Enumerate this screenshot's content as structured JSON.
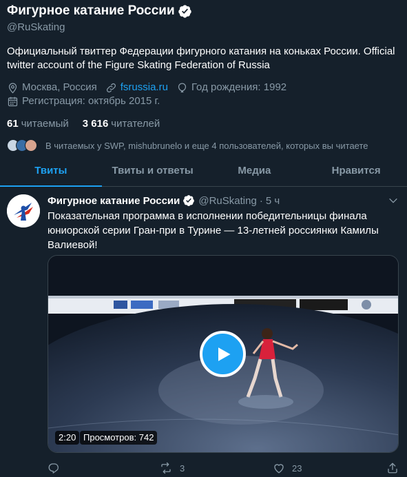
{
  "profile": {
    "display_name": "Фигурное катание России",
    "handle": "@RuSkating",
    "bio": "Официальный твиттер Федерации фигурного катания на коньках России. Official twitter account of the Figure Skating Federation of Russia",
    "location": "Москва, Россия",
    "website": "fsrussia.ru",
    "birth": "Год рождения: 1992",
    "joined": "Регистрация: октябрь 2015 г.",
    "following_count": "61",
    "following_label": "читаемый",
    "followers_count": "3 616",
    "followers_label": "читателей",
    "followed_by": "В читаемых у SWP, mishubrunelo и еще 4 пользователей, которых вы читаете"
  },
  "tabs": [
    {
      "label": "Твиты"
    },
    {
      "label": "Твиты и ответы"
    },
    {
      "label": "Медиа"
    },
    {
      "label": "Нравится"
    }
  ],
  "tweet": {
    "name": "Фигурное катание России",
    "handle": "@RuSkating",
    "dot": "·",
    "time": "5 ч",
    "text": "Показательная программа в исполнении победительницы финала юниорской серии Гран-при в Турине — 13-летней россиянки Камилы Валиевой!",
    "video_duration": "2:20",
    "video_views": "Просмотров: 742",
    "reply_count": "",
    "retweet_count": "3",
    "like_count": "23"
  },
  "colors": {
    "background": "#15202b",
    "accent": "#1da1f2",
    "secondary_text": "#8899a6",
    "divider": "#38444d"
  },
  "icons": [
    "verified-badge-icon",
    "location-icon",
    "link-icon",
    "balloon-icon",
    "calendar-icon",
    "chevron-down-icon",
    "play-icon",
    "reply-icon",
    "retweet-icon",
    "like-icon",
    "share-icon"
  ]
}
